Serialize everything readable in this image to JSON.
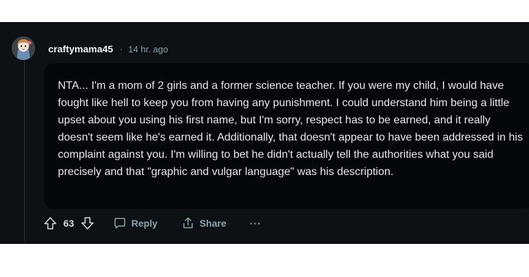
{
  "comment": {
    "username": "craftymama45",
    "separator": "·",
    "time": "14 hr. ago",
    "body": "NTA... I'm a mom of 2 girls and a former science teacher. If you were my child, I would have fought like hell to keep you from having any punishment. I could understand him being a little upset about you using his first name, but I'm sorry, respect has to be earned, and it really doesn't seem like he's earned it. Additionally, that doesn't appear to have been addressed in his complaint against you. I'm willing to bet he didn't actually tell the authorities what you said precisely and that \"graphic and vulgar language\" was his description.",
    "score": "63"
  },
  "actions": {
    "reply_label": "Reply",
    "share_label": "Share",
    "more_label": "···"
  },
  "icons": {
    "upvote": "arrow-up-icon",
    "downvote": "arrow-down-icon",
    "reply": "speech-bubble-icon",
    "share": "share-upload-icon"
  },
  "colors": {
    "background": "#0e1113",
    "bubble": "#050709",
    "text": "#e6e9ea",
    "muted": "#8ba2ad"
  }
}
